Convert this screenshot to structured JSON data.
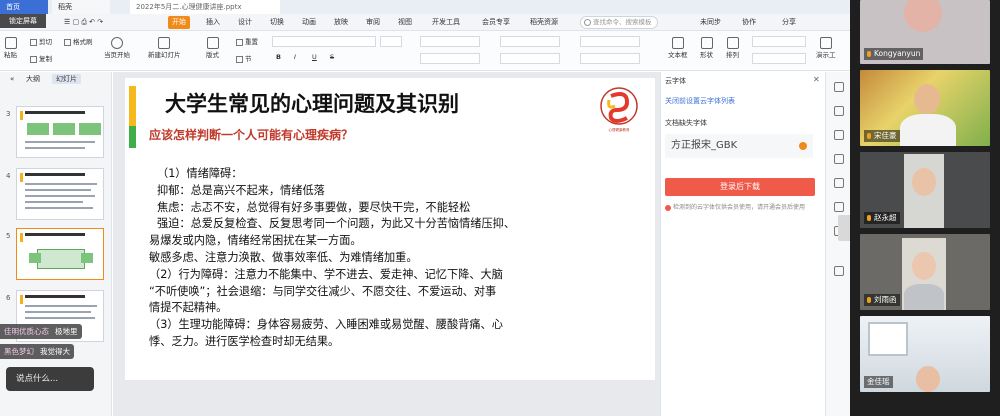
{
  "window": {
    "tabs": [
      "首页",
      "稻壳",
      "2022年5月二.心理健康讲座.pptx"
    ],
    "lock_screen_label": "锁定屏幕"
  },
  "menu": {
    "items": [
      "开始",
      "插入",
      "设计",
      "切换",
      "动画",
      "放映",
      "审阅",
      "视图",
      "开发工具",
      "会员专享",
      "稻壳资源"
    ],
    "active": "开始",
    "search_placeholder": "查找命令、搜索模板",
    "right_items": [
      "未同步",
      "协作",
      "分享"
    ]
  },
  "ribbon": {
    "large_buttons": [
      "粘贴",
      "当页开始",
      "新建幻灯片",
      "版式",
      "节",
      "文本框",
      "形状",
      "排列",
      "演示工"
    ],
    "small_buttons": [
      "剪切",
      "复制",
      "格式刷",
      "重置"
    ],
    "format_buttons": [
      "B",
      "I",
      "U",
      "S"
    ]
  },
  "left_pane": {
    "tabs": [
      "大纲",
      "幻灯片"
    ],
    "active_tab": "幻灯片",
    "thumbnails": [
      3,
      4,
      5,
      6
    ],
    "selected": 5
  },
  "chat": {
    "messages": [
      {
        "name": "佳明优质心态",
        "text": "极地里"
      },
      {
        "name": "黑色梦幻",
        "text": "我觉得大"
      }
    ],
    "input_placeholder": "说点什么..."
  },
  "slide": {
    "title": "大学生常见的心理问题及其识别",
    "subtitle": "应该怎样判断一个人可能有心理疾病？",
    "logo_text": "心理健康教育",
    "lines": [
      "（1）情绪障碍：",
      "抑郁：总是高兴不起来，情绪低落",
      "焦虑：忐忑不安，总觉得有好多事要做，要尽快干完，不能轻松",
      "强迫：总爱反复检查、反复思考同一个问题，为此又十分苦恼情绪压抑、",
      "易爆发或内隐，情绪经常困扰在某一方面。",
      "敏感多虑、注意力涣散、做事效率低、为难情绪加重。",
      "（2）行为障碍：注意力不能集中、学不进去、爱走神、记忆下降、大脑",
      "“不听使唤”；社会退缩：与同学交往减少、不愿交往、不爱运动、对事",
      "情提不起精神。",
      "（3）生理功能障碍：身体容易疲劳、入睡困难或易觉醒、腰酸背痛、心",
      "悸、乏力。进行医学检查时却无结果。"
    ]
  },
  "task_pane": {
    "header": "云字体",
    "link": "关闭前设置云字体列表",
    "label": "文档缺失字体",
    "font_name": "方正报宋_GBK",
    "download_button": "登录后下载",
    "note": "检测到的云字体仅供会员使用，请开通会员后使用"
  },
  "video": {
    "participants": [
      {
        "name": "Kongyanyun",
        "mic": true
      },
      {
        "name": "宋佳豪",
        "mic": true
      },
      {
        "name": "赵永超",
        "mic": true
      },
      {
        "name": "刘雨函",
        "mic": true
      },
      {
        "name": "金佳瑶",
        "mic": false
      }
    ]
  }
}
